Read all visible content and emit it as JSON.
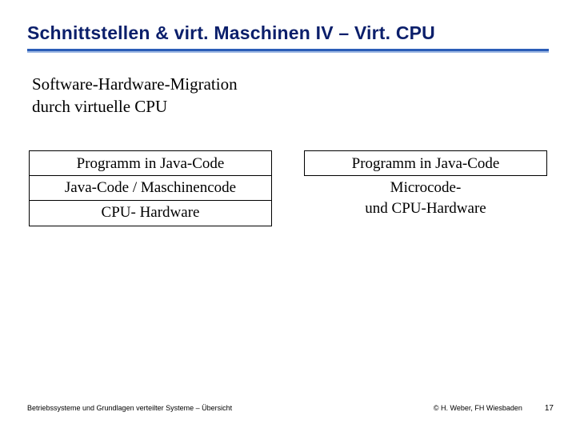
{
  "title": "Schnittstellen & virt. Maschinen IV – Virt. CPU",
  "subtitle_l1": "Software-Hardware-Migration",
  "subtitle_l2": "durch virtuelle CPU",
  "left": {
    "row1": "Programm in Java-Code",
    "row2": "Java-Code / Maschinencode",
    "row3": "CPU- Hardware"
  },
  "right": {
    "row1": "Programm in Java-Code",
    "below_l1": "Microcode-",
    "below_l2": "und CPU-Hardware"
  },
  "footer": {
    "left": "Betriebssysteme und Grundlagen verteilter Systeme – Übersicht",
    "mid": "© H. Weber, FH Wiesbaden",
    "page": "17"
  }
}
